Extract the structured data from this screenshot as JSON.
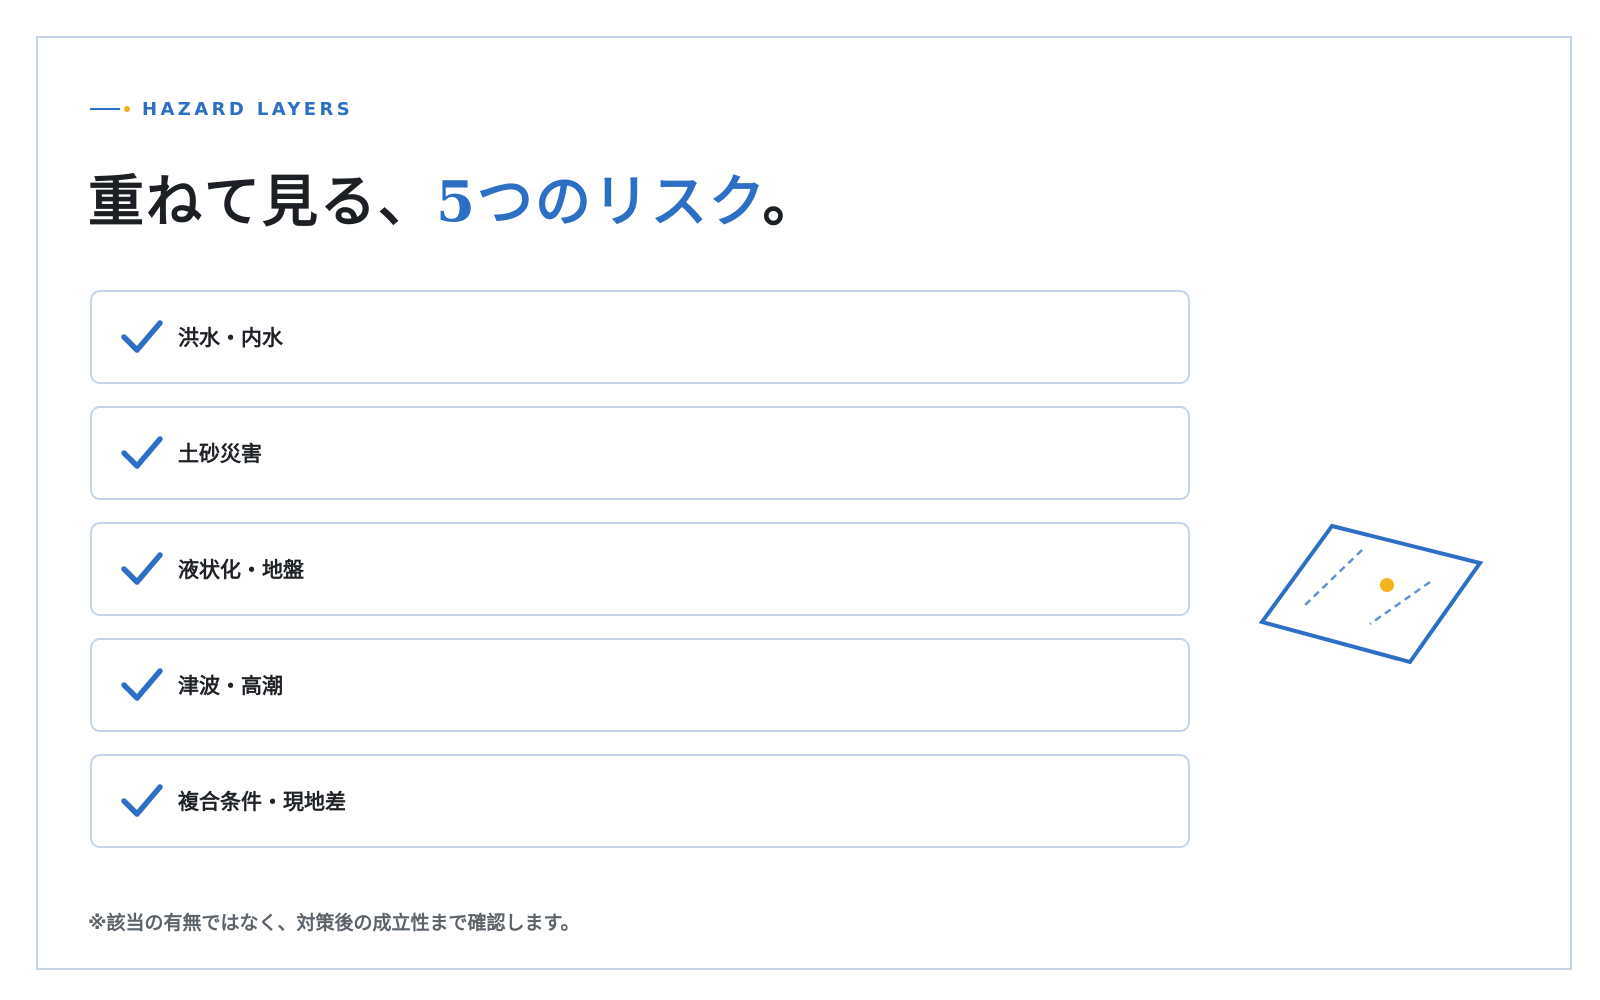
{
  "eyebrow": {
    "label": "HAZARD LAYERS"
  },
  "headline": {
    "text_plain": "重ねて見る、",
    "text_accent": "5つのリスク",
    "text_end": "。"
  },
  "risks": [
    {
      "label": "洪水・内水"
    },
    {
      "label": "土砂災害"
    },
    {
      "label": "液状化・地盤"
    },
    {
      "label": "津波・高潮"
    },
    {
      "label": "複合条件・現地差"
    }
  ],
  "footnote": "※該当の有無ではなく、対策後の成立性まで確認します。",
  "icons": {
    "check": "checkmark-icon",
    "map": "layered-map-icon"
  },
  "colors": {
    "accent": "#2d6fc4",
    "highlight": "#f2b31d",
    "border": "#c5d6e8",
    "text": "#1f2328",
    "muted": "#5c636b"
  }
}
